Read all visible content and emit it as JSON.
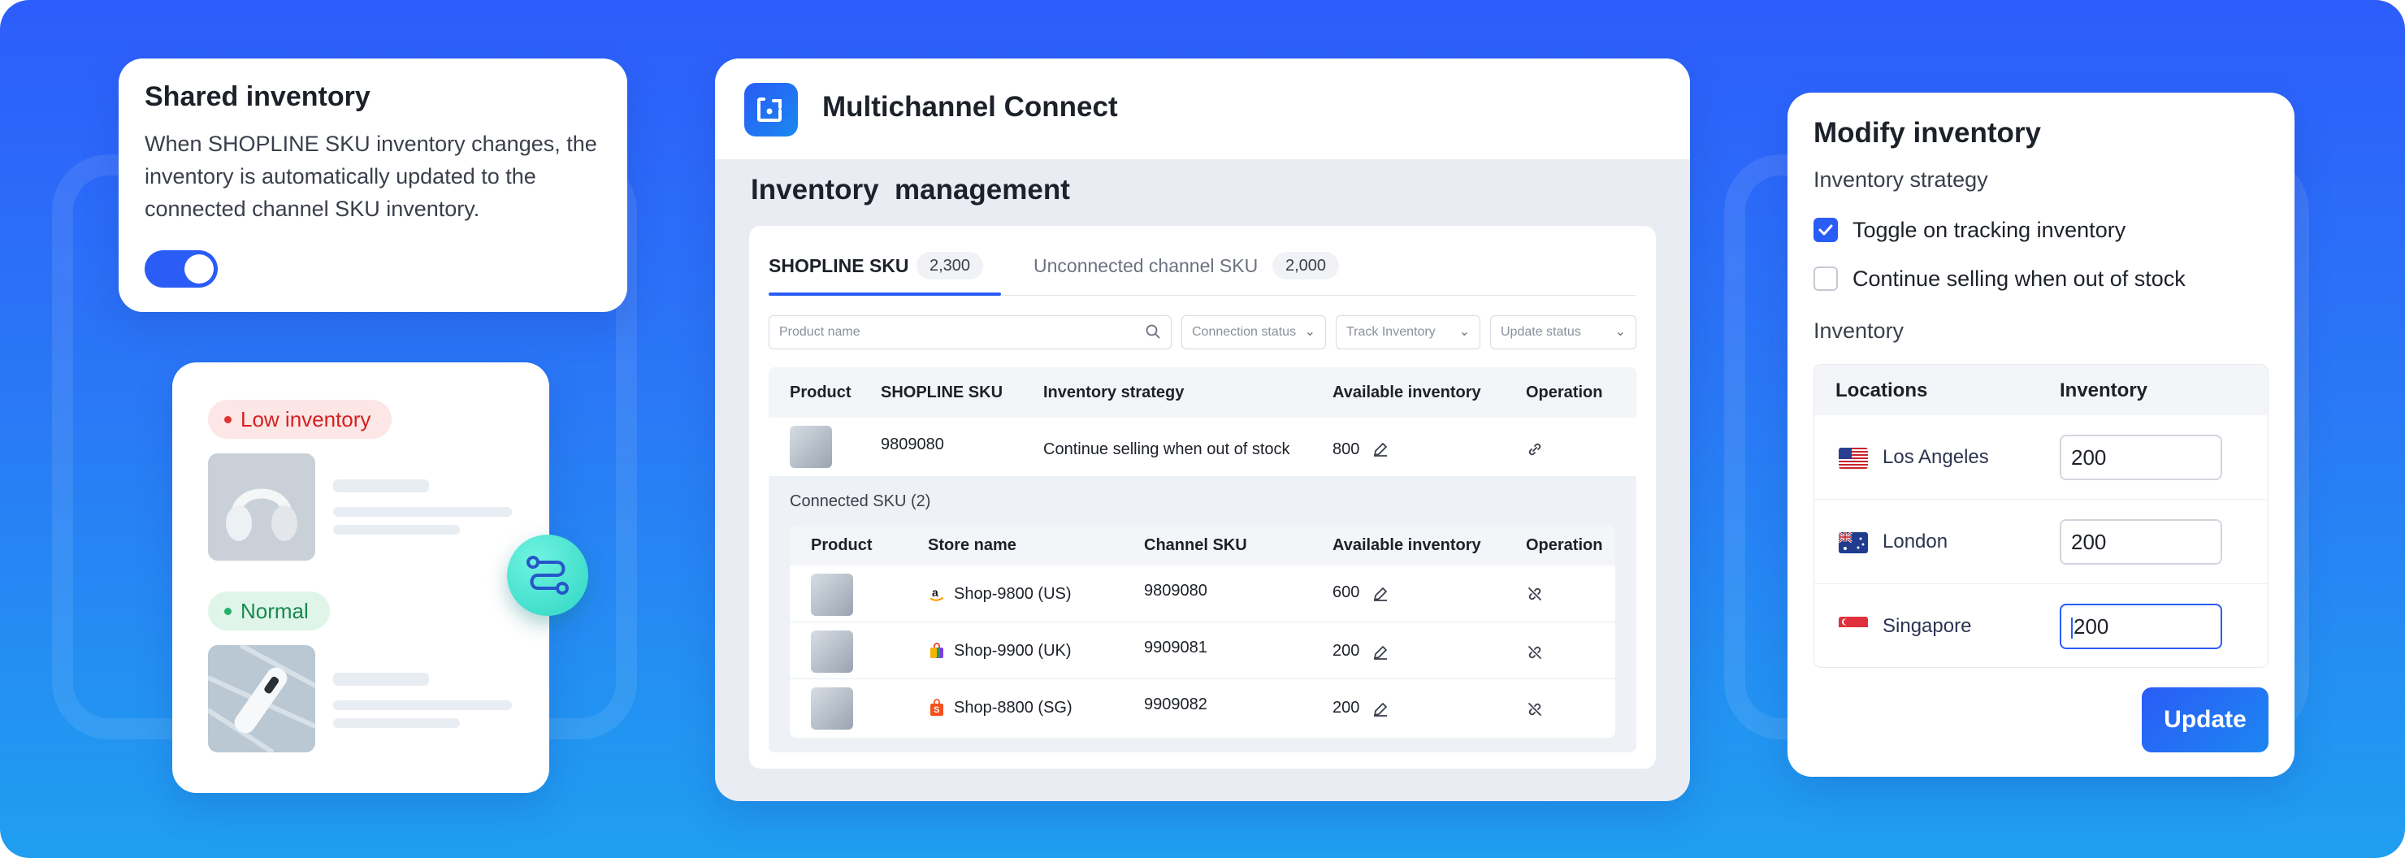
{
  "shared": {
    "title": "Shared inventory",
    "description": "When SHOPLINE SKU inventory changes, the inventory is automatically updated to the connected channel SKU inventory.",
    "toggle_on": true
  },
  "status_card": {
    "low_label": "Low inventory",
    "normal_label": "Normal"
  },
  "app": {
    "title": "Multichannel Connect",
    "page_title": "Inventory  management"
  },
  "tabs": [
    {
      "label": "SHOPLINE SKU",
      "count": "2,300"
    },
    {
      "label": "Unconnected channel SKU",
      "count": "2,000"
    }
  ],
  "filters": {
    "search_placeholder": "Product name",
    "connection_status": "Connection status",
    "track_inventory": "Track Inventory",
    "update_status": "Update status"
  },
  "main_table": {
    "headers": [
      "Product",
      "SHOPLINE SKU",
      "Inventory strategy",
      "Available inventory",
      "Operation"
    ],
    "row": {
      "sku": "9809080",
      "strategy": "Continue selling when out of stock",
      "available": "800"
    }
  },
  "connected": {
    "label": "Connected SKU (2)",
    "headers": [
      "Product",
      "Store name",
      "Channel SKU",
      "Available inventory",
      "Operation"
    ],
    "rows": [
      {
        "store": "Shop-9800 (US)",
        "sku": "9809080",
        "available": "600",
        "store_icon": "amazon-icon"
      },
      {
        "store": "Shop-9900 (UK)",
        "sku": "9909081",
        "available": "200",
        "store_icon": "shopping-bag-icon"
      },
      {
        "store": "Shop-8800 (SG)",
        "sku": "9909082",
        "available": "200",
        "store_icon": "shopee-icon"
      }
    ]
  },
  "modify": {
    "title": "Modify inventory",
    "strategy_label": "Inventory strategy",
    "option_tracking": "Toggle on tracking inventory",
    "option_tracking_checked": true,
    "option_continue": "Continue selling when out of stock",
    "option_continue_checked": false,
    "inventory_label": "Inventory",
    "headers": [
      "Locations",
      "Inventory"
    ],
    "locations": [
      {
        "name": "Los Angeles",
        "value": "200",
        "flag": "us-flag-icon"
      },
      {
        "name": "London",
        "value": "200",
        "flag": "au-flag-icon"
      },
      {
        "name": "Singapore",
        "value": "200",
        "flag": "sg-flag-icon"
      }
    ],
    "update_label": "Update"
  },
  "colors": {
    "accent": "#2a5cf6",
    "low": "#d42121",
    "normal": "#16894e",
    "teal": "#2fd6c4"
  }
}
